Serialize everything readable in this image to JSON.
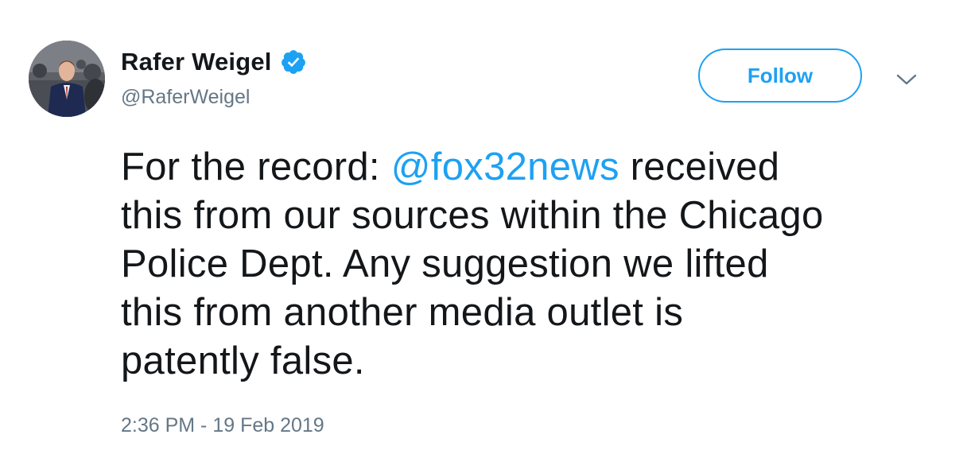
{
  "user": {
    "display_name": "Rafer Weigel",
    "handle": "@RaferWeigel",
    "verified": true
  },
  "actions": {
    "follow_label": "Follow",
    "menu_icon": "chevron-down-icon"
  },
  "tweet": {
    "line1_before": "For the record: ",
    "line1_mention": "@fox32news",
    "line1_after": " received",
    "line2": "this from our sources within the Chicago",
    "line3": "Police Dept. Any suggestion we lifted",
    "line4": "this from another media outlet is",
    "line5": "patently false.",
    "timestamp": "2:36 PM - 19 Feb 2019"
  },
  "colors": {
    "accent": "#1da1f2",
    "text": "#14171a",
    "secondary_text": "#657786"
  }
}
